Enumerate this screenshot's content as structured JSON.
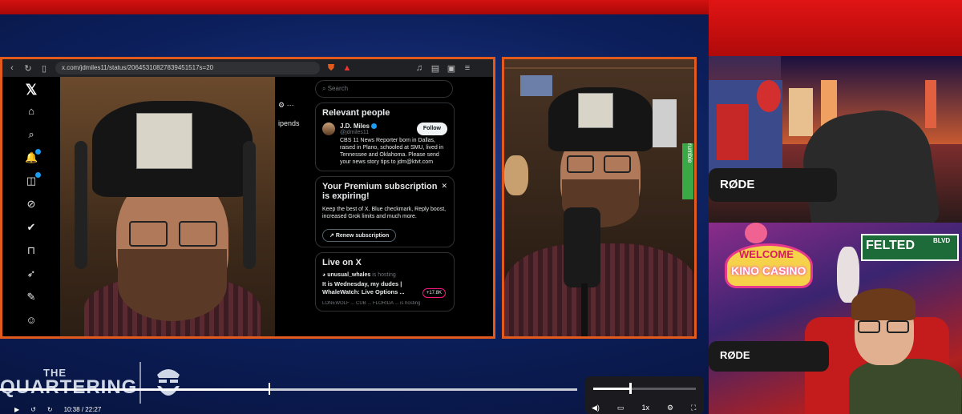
{
  "browser": {
    "url": "x.com/jdmiles11/status/20645310827839451517s=20",
    "nav_icons": [
      "back-icon",
      "reload-icon",
      "bookmark-icon"
    ],
    "x_nav": [
      {
        "icon": "x-logo-icon",
        "glyph": "𝕏"
      },
      {
        "icon": "home-icon",
        "glyph": "⌂"
      },
      {
        "icon": "search-icon",
        "glyph": "⌕"
      },
      {
        "icon": "bell-icon",
        "glyph": "🔔"
      },
      {
        "icon": "chat-icon",
        "glyph": "◫"
      },
      {
        "icon": "grok-icon",
        "glyph": "⊘"
      },
      {
        "icon": "verified-icon",
        "glyph": "✔"
      },
      {
        "icon": "bookmark-icon",
        "glyph": "⊓"
      },
      {
        "icon": "rocket-icon",
        "glyph": "➶"
      },
      {
        "icon": "edit-icon",
        "glyph": "✎"
      },
      {
        "icon": "profile-icon",
        "glyph": "☺"
      }
    ],
    "feed_fragment": "ipends",
    "search_placeholder": "Search",
    "relevant_people": {
      "heading": "Relevant people",
      "name": "J.D. Miles",
      "handle": "@jdmiles11",
      "follow_label": "Follow",
      "bio": "CBS 11 News Reporter born in Dallas, raised in Plano, schooled at SMU, lived in Tennessee and Oklahoma. Please send your news story tips to jdm@ktvt.com"
    },
    "premium": {
      "heading": "Your Premium subscription is expiring!",
      "body": "Keep the best of X. Blue checkmark, Reply boost, increased Grok limits and much more.",
      "button_label": "Renew subscription"
    },
    "live": {
      "heading": "Live on X",
      "host": "unusual_whales",
      "host_suffix": "is hosting",
      "title": "It is Wednesday, my dudes | WhaleWatch: Live Options ...",
      "count": "+17.8K",
      "footer": "LONEWOLF ... CUB ... FLORIDA ... is hosting"
    }
  },
  "overlay": {
    "rode_label_1": "RØDE",
    "rode_label_2": "RØDE",
    "rumble_text": "rumble",
    "welcome_sign": "WELCOME",
    "kino_sign": "KINO CASINO",
    "felted_sign": "FELTED",
    "felted_blvd": "BLVD"
  },
  "branding": {
    "the": "THE",
    "name": "QUARTERING"
  },
  "player": {
    "progress": 0.467,
    "time_current": "10:38",
    "time_total": "22:27",
    "volume": 0.35,
    "speed": "1x",
    "play_icon": "play-icon",
    "prev_icon": "skip-back-icon",
    "next_icon": "skip-forward-icon",
    "volume_icon": "volume-icon",
    "settings_icon": "gear-icon",
    "fullscreen_icon": "fullscreen-icon"
  }
}
